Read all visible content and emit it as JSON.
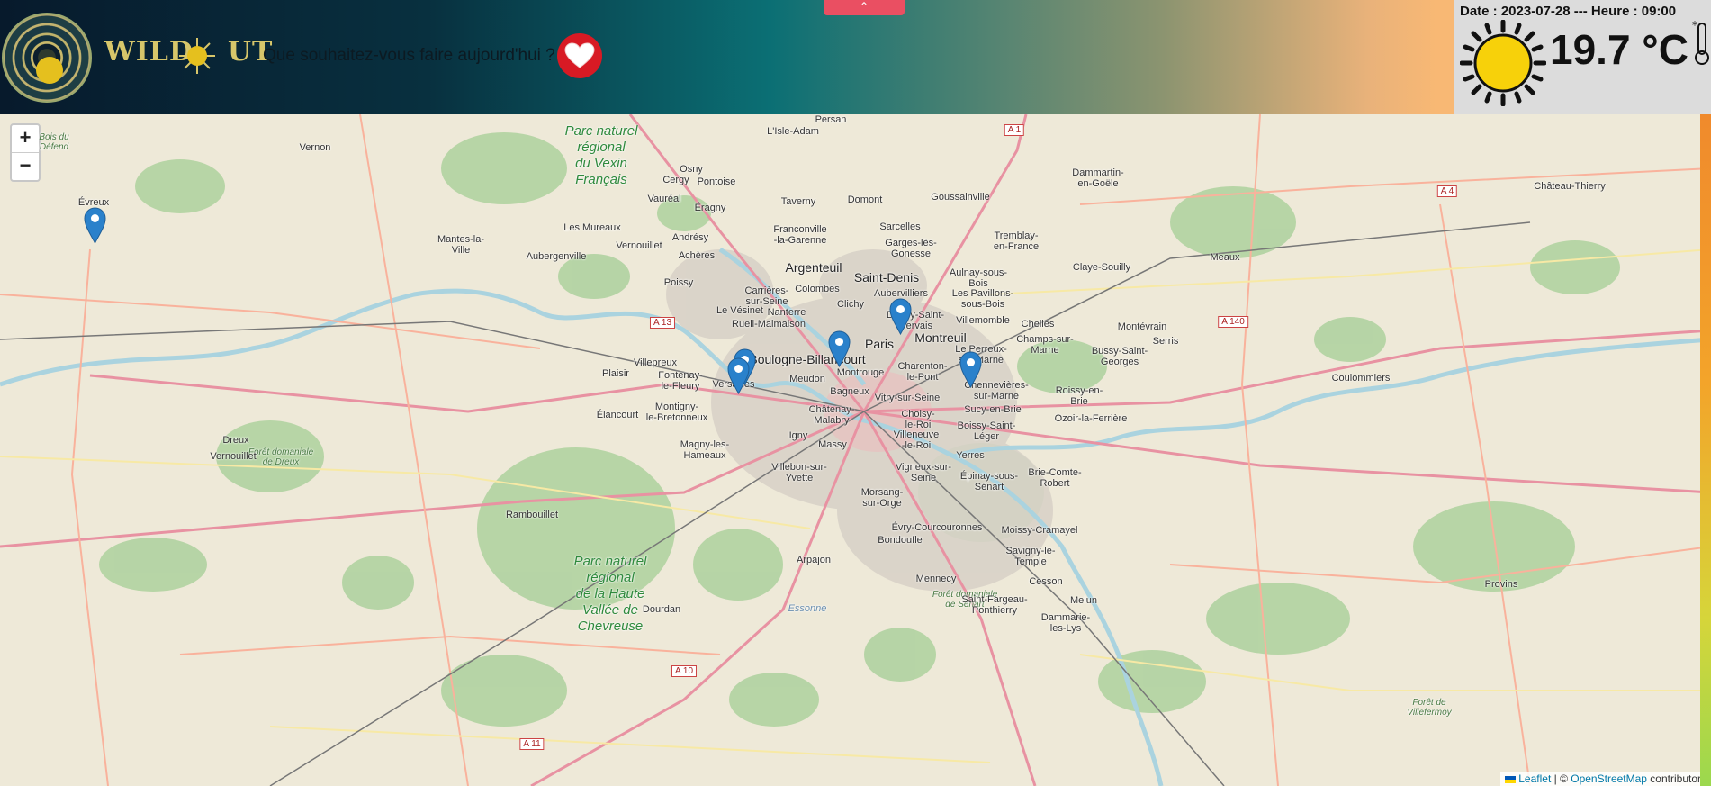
{
  "header": {
    "brand": "WILDOUT",
    "brand_left": "WILD",
    "brand_right": "UT",
    "question": "Que souhaitez-vous faire aujourd'hui ?",
    "toggle_glyph": "⌃",
    "heart_icon": "heart-icon"
  },
  "weather": {
    "date_line": "Date : 2023-07-28 --- Heure : 09:00",
    "temperature": "19.7 °C",
    "condition_icon": "sun-icon"
  },
  "map": {
    "zoom_in": "+",
    "zoom_out": "−",
    "attribution_leaflet": "Leaflet",
    "attribution_sep": " | © ",
    "attribution_osm": "OpenStreetMap",
    "attribution_tail": " contributors",
    "labels": {
      "paris": "Paris",
      "saint_denis": "Saint-Denis",
      "montreuil": "Montreuil",
      "boulogne": "Boulogne-Billancourt",
      "argenteuil": "Argenteuil",
      "versailles": "Versailles",
      "evreux": "Évreux",
      "vernon": "Vernon",
      "mantes": "Mantes-la-\nVille",
      "persan": "Persan",
      "lisle_adam": "L'Isle-Adam",
      "pontoise": "Pontoise",
      "cergy": "Cergy",
      "osny": "Osny",
      "meaux": "Meaux",
      "chateau_thierry": "Château-Thierry",
      "coulommiers": "Coulommiers",
      "dreux": "Dreux",
      "vernouillet_dreux": "Vernouillet",
      "rambouillet": "Rambouillet",
      "evry": "Évry-Courcouronnes",
      "melun": "Melun",
      "provins": "Provins",
      "dammartin": "Dammartin-\nen-Goële",
      "claye": "Claye-Souilly",
      "chelles": "Chelles",
      "poissy": "Poissy",
      "plaisir": "Plaisir",
      "elancourt": "Élancourt",
      "massy": "Massy",
      "creteil_area": "Chennevières-\nsur-Marne",
      "yerres": "Yerres",
      "bonneuil": "Bussy-Saint-\nGeorges",
      "dourdan": "Dourdan",
      "arpajon": "Arpajon",
      "mennecy": "Mennecy",
      "cesson": "Cesson",
      "serris": "Serris",
      "montevrain": "Montévrain",
      "roissy_brie": "Roissy-en-\nBrie",
      "ozoir": "Ozoir-la-Ferrière",
      "brie_comte": "Brie-Comte-\nRobert",
      "aubergenville": "Aubergenville",
      "les_mureaux": "Les Mureaux",
      "vernouillet": "Vernouillet",
      "andresy": "Andrésy",
      "acheres": "Achères",
      "taverny": "Taverny",
      "domont": "Domont",
      "sarcelles": "Sarcelles",
      "goussainville": "Goussainville",
      "tremblay": "Tremblay-\nen-France",
      "aulnay": "Aulnay-sous-\nBois",
      "clichy": "Clichy",
      "colombes": "Colombes",
      "nanterre": "Nanterre",
      "rueil": "Rueil-Malmaison",
      "montrouge": "Montrouge",
      "meudon": "Meudon",
      "bagneux": "Bagneux",
      "vitry": "Vitry-sur-Seine",
      "igny": "Igny",
      "savigny": "Savigny-le-\nTemple",
      "moissy": "Moissy-Cramayel",
      "dammarie": "Dammarie-\nles-Lys",
      "saint_fargeau": "Saint-Fargeau-\nPonthierry",
      "bondoufle": "Bondoufle",
      "morsang": "Morsang-\nsur-Orge",
      "essonne": "Essonne",
      "villebon": "Villebon-sur-\nYvette",
      "magny": "Magny-les-\nHameaux",
      "montigny": "Montigny-\nle-Bretonneux",
      "fontenay": "Fontenay-\nle-Fleury",
      "villepreux": "Villepreux",
      "franconville": "Franconville\n-la-Garenne",
      "eragny": "Éragny",
      "vaureal": "Vauréal",
      "chatenay": "Châtenay-\nMalabry",
      "vigneux": "Vigneux-sur-\nSeine",
      "villeneuve": "Villeneuve\n-le-Roi",
      "boissy": "Boissy-Saint-\nLéger",
      "sucy": "Sucy-en-Brie",
      "epinay": "Épinay-sous-\nSénart",
      "charenton": "Charenton-\nle-Pont",
      "perreux": "Le Perreux-\nsur-Marne",
      "champs": "Champs-sur-\nMarne",
      "villemomble": "Villemomble",
      "pavillons": "Les Pavillons-\nsous-Bois",
      "aubervilliers": "Aubervilliers",
      "garges": "Garges-lès-\nGonesse",
      "carrieres": "Carrières-\nsur-Seine",
      "vesinet": "Le Vésinet",
      "choisy": "Choisy-\nle-Roi",
      "dugny": "Dugny-Saint-\nGervais"
    },
    "parks": {
      "vexin": "Parc naturel\nrégional\ndu Vexin\nFrançais",
      "chevreuse": "Parc naturel\nrégional\nde la Haute\nVallée de\nChevreuse"
    },
    "forests": {
      "dreux": "Forêt domaniale\nde Dreux",
      "senart": "Forêt domaniale\nde Sénart",
      "villefermoy": "Forêt de\nVillefermoy",
      "bois_defend": "Bois du\nDéfend"
    },
    "roads": {
      "a1": "A 1",
      "a4": "A 4",
      "a13": "A 13",
      "a140": "A 140",
      "a10": "A 10",
      "a11": "A 11"
    }
  }
}
